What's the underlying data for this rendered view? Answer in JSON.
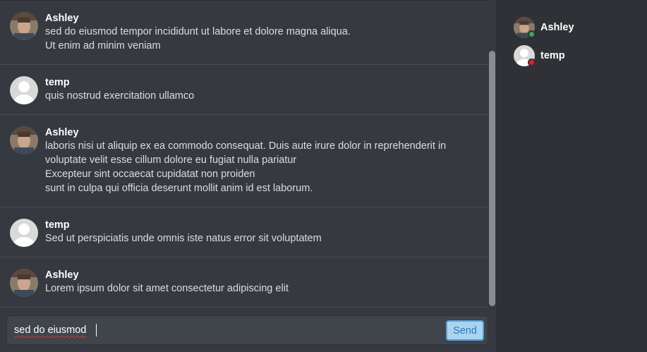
{
  "messages": [
    {
      "author": "Ashley",
      "avatar": "photo-avatar",
      "lines": [
        "sed do eiusmod tempor incididunt ut labore et dolore magna aliqua.",
        "Ut enim ad minim veniam"
      ]
    },
    {
      "author": "temp",
      "avatar": "default-avatar",
      "lines": [
        "quis nostrud exercitation ullamco"
      ]
    },
    {
      "author": "Ashley",
      "avatar": "photo-avatar",
      "lines": [
        "laboris nisi ut aliquip ex ea commodo consequat. Duis aute irure dolor in reprehenderit in",
        "voluptate velit esse cillum dolore eu fugiat nulla pariatur",
        "Excepteur sint occaecat cupidatat non proiden",
        "sunt in culpa qui officia deserunt mollit anim id est laborum."
      ]
    },
    {
      "author": "temp",
      "avatar": "default-avatar",
      "lines": [
        "Sed ut perspiciatis unde omnis iste natus error sit voluptatem"
      ]
    },
    {
      "author": "Ashley",
      "avatar": "photo-avatar",
      "lines": [
        "Lorem ipsum dolor sit amet consectetur adipiscing elit"
      ]
    }
  ],
  "composer": {
    "value": "sed do eiusmod",
    "send_label": "Send"
  },
  "users": [
    {
      "name": "Ashley",
      "avatar": "photo-avatar",
      "status": "online",
      "status_color": "#3ba55c"
    },
    {
      "name": "temp",
      "avatar": "default-avatar",
      "status": "offline",
      "status_color": "#ed1c24"
    }
  ],
  "colors": {
    "background": "#36393f",
    "sidebar": "#2f3136",
    "send_button": "#a9d4f1",
    "online": "#3ba55c",
    "offline": "#ed1c24"
  }
}
